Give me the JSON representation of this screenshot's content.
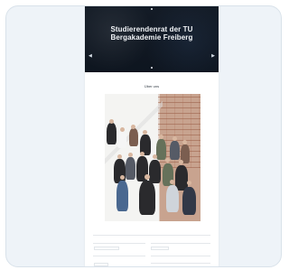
{
  "preview": {
    "hero": {
      "title_line1": "Studierendenrat der TU",
      "title_line2": "Bergakademie Freiberg"
    },
    "section": {
      "title": "Über uns"
    }
  },
  "colors": {
    "card_background": "#eef3f8",
    "hero_background": "#0f1722",
    "photo_wall": "#c8a38f"
  }
}
